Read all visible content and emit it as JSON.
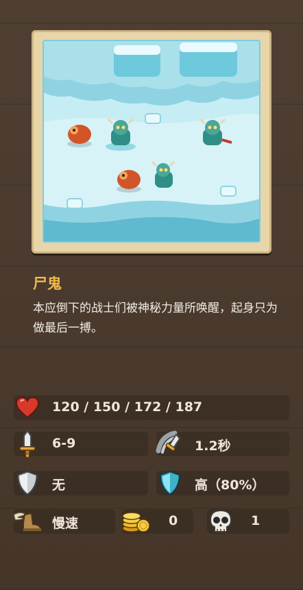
{
  "unit": {
    "name": "尸鬼",
    "description": "本应倒下的战士们被神秘力量所唤醒，起身只为做最后一搏。"
  },
  "stats": {
    "health": {
      "icon": "heart-icon",
      "value": "120 / 150 / 172 / 187"
    },
    "damage": {
      "icon": "sword-icon",
      "value": "6-9"
    },
    "attack_speed": {
      "icon": "attack-speed-icon",
      "value": "1.2秒"
    },
    "armor": {
      "icon": "armor-shield-icon",
      "value": "无"
    },
    "magic_resist": {
      "icon": "magic-shield-icon",
      "value": "高（80%）"
    },
    "move_speed": {
      "icon": "winged-boot-icon",
      "value": "慢速"
    },
    "gold": {
      "icon": "gold-coins-icon",
      "value": "0"
    },
    "lives": {
      "icon": "skull-icon",
      "value": "1"
    }
  },
  "colors": {
    "name": "#f2b84a",
    "text": "#f1ece4",
    "frame": "#e9d6a8",
    "ice": "#bfe9f2"
  }
}
